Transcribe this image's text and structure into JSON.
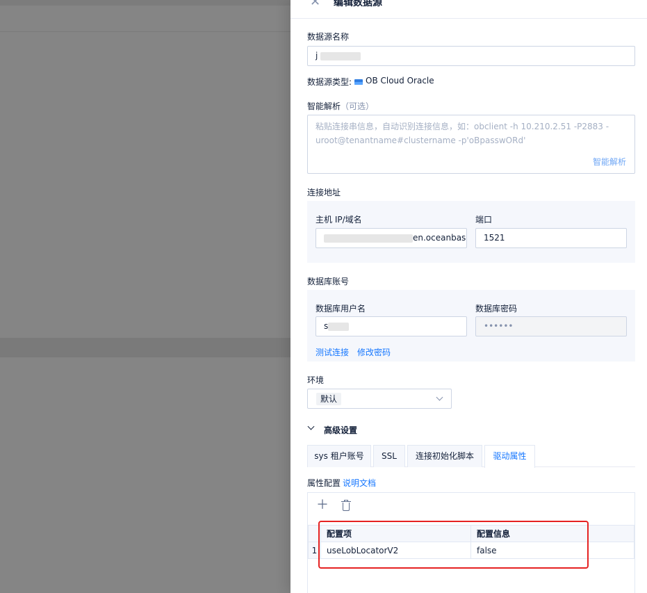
{
  "drawer": {
    "title": "编辑数据源"
  },
  "form": {
    "name_label": "数据源名称",
    "name_value_visible": "j",
    "type_label": "数据源类型:",
    "type_value": "OB Cloud Oracle",
    "type_icon": "ob-cloud-icon",
    "smart_parse_label": "智能解析",
    "smart_parse_optional": "（可选）",
    "smart_parse_placeholder": "粘贴连接串信息，自动识别连接信息，如：obclient -h 10.210.2.51 -P2883 -uroot@tenantname#clustername -p'oBpasswORd'",
    "smart_parse_button": "智能解析",
    "connection_label": "连接地址",
    "host_label": "主机 IP/域名",
    "host_value_visible": "en.oceanbase.a",
    "port_label": "端口",
    "port_value": "1521",
    "account_label": "数据库账号",
    "username_label": "数据库用户名",
    "username_value_visible": "s",
    "password_label": "数据库密码",
    "password_value": "••••••",
    "test_connection": "测试连接",
    "change_password": "修改密码",
    "env_label": "环境",
    "env_value": "默认",
    "advanced_label": "高级设置"
  },
  "tabs": [
    {
      "label": "sys 租户账号",
      "active": false
    },
    {
      "label": "SSL",
      "active": false
    },
    {
      "label": "连接初始化脚本",
      "active": false
    },
    {
      "label": "驱动属性",
      "active": true
    }
  ],
  "properties": {
    "label": "属性配置",
    "doc_link": "说明文档",
    "columns": [
      "配置项",
      "配置信息"
    ],
    "rows": [
      {
        "index": "1",
        "key": "useLobLocatorV2",
        "value": "false"
      }
    ]
  },
  "colors": {
    "primary": "#1677ff",
    "highlight_box": "#e52222",
    "mask": "#858585"
  }
}
